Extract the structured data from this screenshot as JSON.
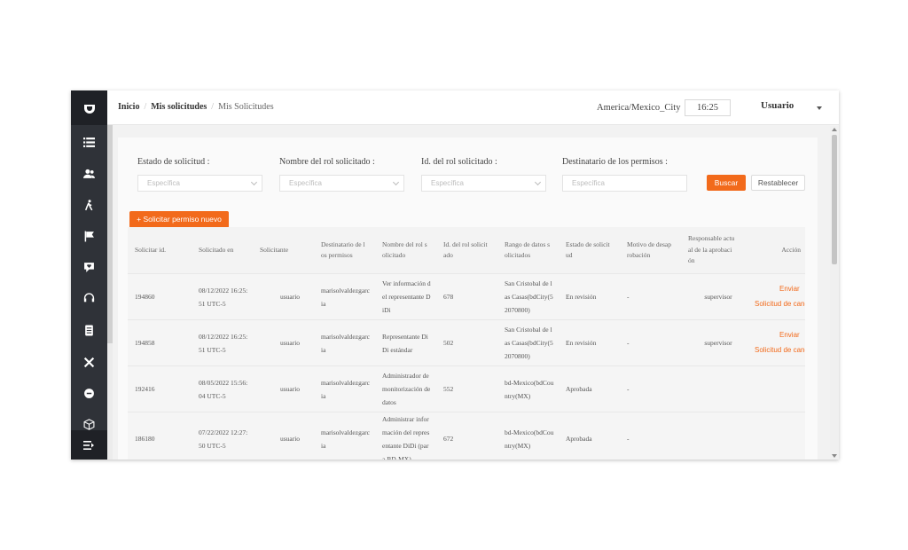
{
  "header": {
    "breadcrumb": [
      "Inicio",
      "Mis solicitudes",
      "Mis Solicitudes"
    ],
    "breadcrumb_sep": "/",
    "timezone": "America/Mexico_City",
    "time": "16:25",
    "user": "Usuario"
  },
  "sidebar": {
    "icons": [
      "list-icon",
      "users-icon",
      "walking-person-icon",
      "flag-icon",
      "heart-chat-icon",
      "headset-icon",
      "document-icon",
      "tools-icon",
      "circle-icon",
      "cube-icon"
    ],
    "collapse_icon": "collapse-menu-icon"
  },
  "filters": [
    {
      "label": "Estado de solicitud :",
      "placeholder": "Específica"
    },
    {
      "label": "Nombre del rol solicitado :",
      "placeholder": "Específica"
    },
    {
      "label": "Id. del rol solicitado :",
      "placeholder": "Específica"
    },
    {
      "label": "Destinatario de los permisos :",
      "placeholder": "Específica"
    }
  ],
  "buttons": {
    "search": "Buscar",
    "reset": "Restablecer",
    "new_request": "+  Solicitar permiso nuevo"
  },
  "table": {
    "columns": [
      "Solicitar id.",
      "Solicitado en",
      "Solicitante",
      "Destinatario de l\nos permisos",
      "Nombre del rol s\nolicitado",
      "Id. del rol solicit\nado",
      "Rango de datos s\nolicitados",
      "Estado de solicit\nud",
      "Motivo de desap\nrobación",
      "Responsable actu\nal de la aprobaci\nón",
      "Acción"
    ],
    "rows": [
      {
        "id": "194860",
        "date": "08/12/2022 16:25:\n51 UTC-5",
        "requester": "usuario",
        "recipient": "marisolvaldezgarc\nia",
        "role_name": "Ver información d\nel representante D\niDi",
        "role_id": "678",
        "range": "San Cristobal de l\nas Casas(bdCity(5\n2070800)",
        "status": "En revisión",
        "reason": "-",
        "approver": "supervisor",
        "actions": [
          "Enviar",
          "Solicitud de cancelación"
        ]
      },
      {
        "id": "194858",
        "date": "08/12/2022 16:25:\n51 UTC-5",
        "requester": "usuario",
        "recipient": "marisolvaldezgarc\nia",
        "role_name": "Representante Di\nDi estándar",
        "role_id": "502",
        "range": "San Cristobal de l\nas Casas(bdCity(5\n2070800)",
        "status": "En revisión",
        "reason": "-",
        "approver": "supervisor",
        "actions": [
          "Enviar",
          "Solicitud de cancelación"
        ]
      },
      {
        "id": "192416",
        "date": "08/05/2022 15:56:\n04 UTC-5",
        "requester": "usuario",
        "recipient": "marisolvaldezgarc\nia",
        "role_name": "Administrador de\nmonitorización de\ndatos",
        "role_id": "552",
        "range": "bd-Mexico(bdCou\nntry(MX)",
        "status": "Aprobada",
        "reason": "-",
        "approver": "",
        "actions": []
      },
      {
        "id": "186180",
        "date": "07/22/2022 12:27:\n50 UTC-5",
        "requester": "usuario",
        "recipient": "marisolvaldezgarc\nia",
        "role_name": "Administrar infor\nmación del repres\nentante DiDi (par\na BD-MX)",
        "role_id": "672",
        "range": "bd-Mexico(bdCou\nntry(MX)",
        "status": "Aprobada",
        "reason": "-",
        "approver": "",
        "actions": []
      }
    ]
  }
}
